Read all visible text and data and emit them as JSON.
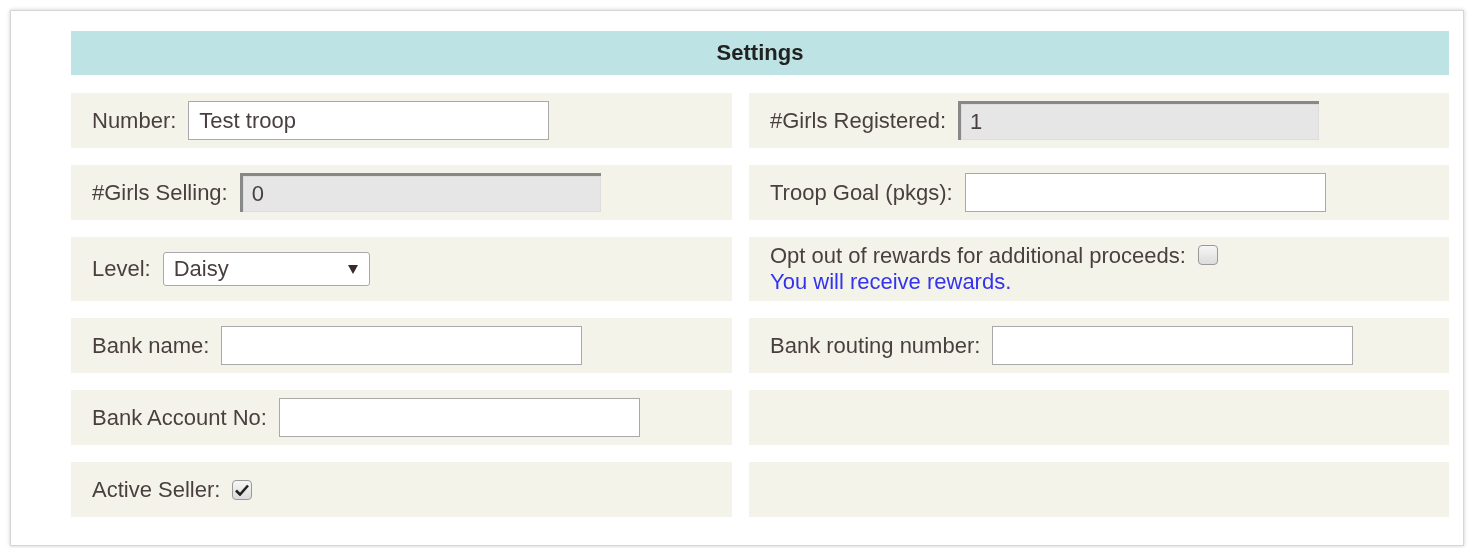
{
  "header": {
    "title": "Settings"
  },
  "rows": [
    [
      {
        "kind": "text",
        "label": "Number:",
        "value": "Test troop",
        "readonly": false
      },
      {
        "kind": "text",
        "label": "#Girls Registered:",
        "value": "1",
        "readonly": true
      }
    ],
    [
      {
        "kind": "text",
        "label": "#Girls Selling:",
        "value": "0",
        "readonly": true
      },
      {
        "kind": "text",
        "label": "Troop Goal (pkgs):",
        "readonly": false
      }
    ],
    [
      {
        "kind": "select",
        "label": "Level:",
        "value": "Daisy"
      },
      {
        "kind": "checkbox",
        "label": "Opt out of rewards for additional proceeds:",
        "checked": false,
        "note": "You will receive rewards."
      }
    ],
    [
      {
        "kind": "text",
        "label": "Bank name:",
        "readonly": false
      },
      {
        "kind": "text",
        "label": "Bank routing number:",
        "readonly": false
      }
    ],
    [
      {
        "kind": "text",
        "label": "Bank Account No:",
        "readonly": false
      },
      {
        "kind": "empty"
      }
    ],
    [
      {
        "kind": "checkbox",
        "label": "Active Seller:",
        "checked": true
      },
      {
        "kind": "empty"
      }
    ]
  ]
}
